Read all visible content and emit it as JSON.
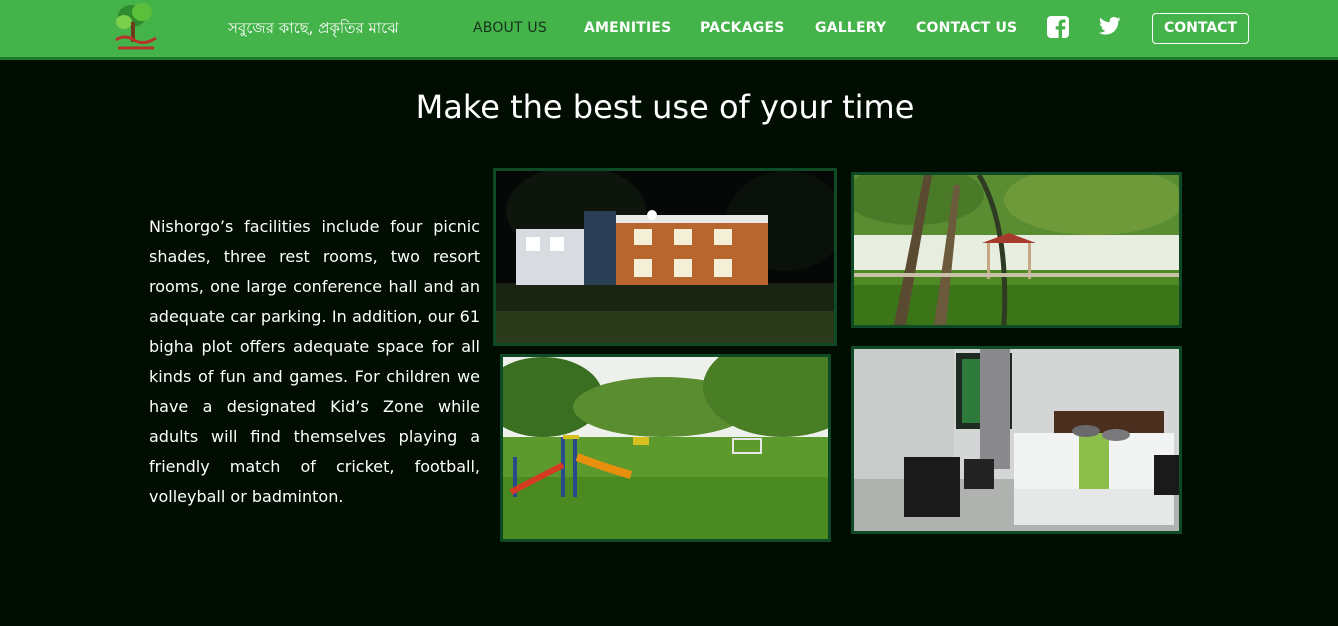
{
  "nav": {
    "tagline": "সবুজের কাছে, প্রকৃতির মাঝে",
    "links": [
      {
        "label": "ABOUT US"
      },
      {
        "label": "AMENITIES"
      },
      {
        "label": "PACKAGES"
      },
      {
        "label": "GALLERY"
      },
      {
        "label": "CONTACT US"
      }
    ],
    "social_icons": [
      "facebook-icon",
      "twitter-icon"
    ],
    "contact_button": "CONTACT",
    "brand_color": "#44b34a",
    "active_link_color": "#16321a"
  },
  "main": {
    "heading": "Make the best use of your time",
    "description": "Nishorgo’s facilities include four picnic shades, three rest rooms, two resort rooms, one large conference hall and an adequate car parking. In addition, our 61 bigha plot offers adequate space for all kinds of fun and games. For children we have a designated Kid’s Zone while adults will find themselves playing a friendly match of cricket, football, volleyball or badminton.",
    "background_color": "#000d00",
    "photo_border_color": "#0e4a26",
    "photos": [
      {
        "subject": "resort building at night"
      },
      {
        "subject": "gazebo among trees"
      },
      {
        "subject": "kids playground on lawn"
      },
      {
        "subject": "resort bedroom"
      }
    ]
  }
}
